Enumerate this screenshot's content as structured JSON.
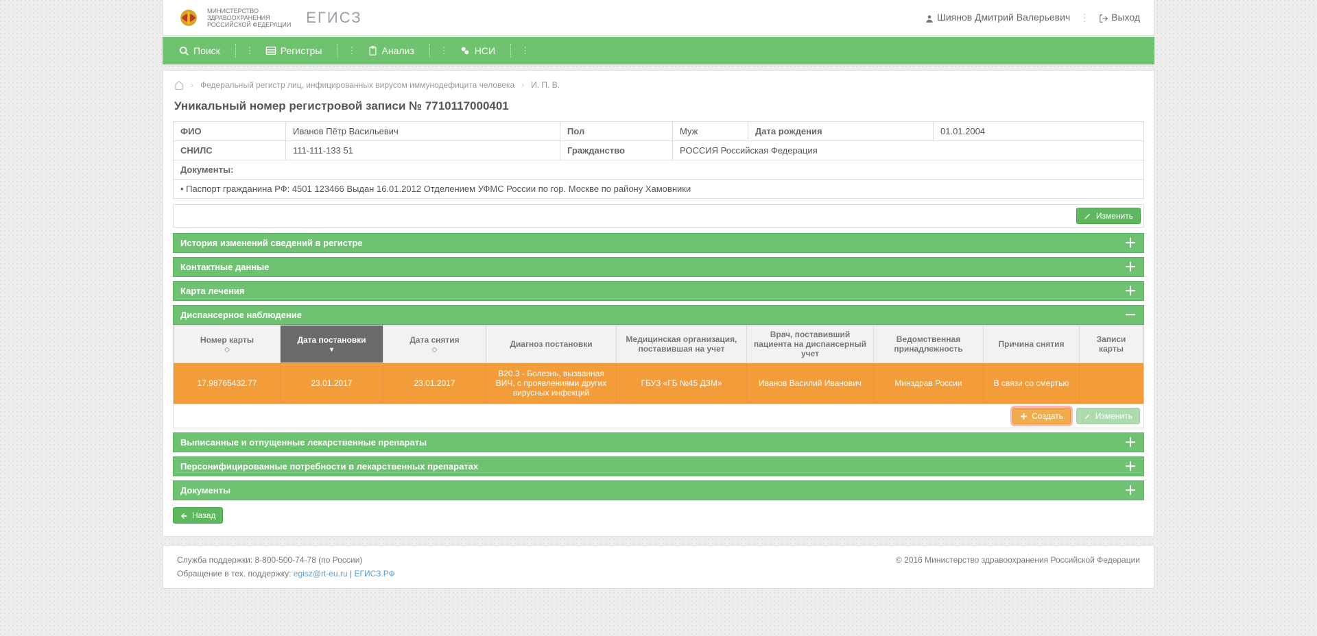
{
  "header": {
    "ministry_line1": "МИНИСТЕРСТВО",
    "ministry_line2": "ЗДРАВООХРАНЕНИЯ",
    "ministry_line3": "РОССИЙСКОЙ ФЕДЕРАЦИИ",
    "brand": "ЕГИСЗ",
    "user": "Шиянов Дмитрий Валерьевич",
    "logout": "Выход"
  },
  "nav": {
    "search": "Поиск",
    "registers": "Регистры",
    "analysis": "Анализ",
    "nsi": "НСИ"
  },
  "crumbs": {
    "l1": "Федеральный регистр лиц, инфицированных вирусом иммунодефицита человека",
    "l2": "И. П. В."
  },
  "title": "Уникальный номер регистровой записи № 7710117000401",
  "summary": {
    "fio_label": "ФИО",
    "fio": "Иванов Пётр Васильевич",
    "sex_label": "Пол",
    "sex": "Муж",
    "dob_label": "Дата рождения",
    "dob": "01.01.2004",
    "snils_label": "СНИЛС",
    "snils": "111-111-133 51",
    "citizen_label": "Гражданство",
    "citizen": "РОССИЯ Российская Федерация",
    "docs_label": "Документы:",
    "doc1": "• Паспорт гражданина РФ: 4501 123466 Выдан 16.01.2012 Отделением УФМС России по гор. Москве по району Хамовники"
  },
  "buttons": {
    "edit": "Изменить",
    "create": "Создать",
    "back": "Назад"
  },
  "sections": {
    "history": "История изменений сведений в регистре",
    "contacts": "Контактные данные",
    "treatment": "Карта лечения",
    "dispanser": "Диспансерное наблюдение",
    "drugs_out": "Выписанные и отпущенные лекарственные препараты",
    "drugs_need": "Персонифицированные потребности в лекарственных препаратах",
    "documents": "Документы"
  },
  "dispanser": {
    "cols": {
      "card_no": "Номер карты",
      "date_on": "Дата постановки",
      "date_off": "Дата снятия",
      "diag": "Диагноз постановки",
      "org": "Медицинская организация, поставившая на учет",
      "doctor": "Врач, поставивший пациента на диспансерный учет",
      "dept": "Ведомственная принадлежность",
      "reason": "Причина снятия",
      "records": "Записи карты"
    },
    "row": {
      "card_no": "17.98765432.77",
      "date_on": "23.01.2017",
      "date_off": "23.01.2017",
      "diag": "B20.3 - Болезнь, вызванная ВИЧ, с проявлениями других вирусных инфекций",
      "org": "ГБУЗ «ГБ №45 ДЗМ»",
      "doctor": "Иванов Василий Иванович",
      "dept": "Минздрав России",
      "reason": "В связи со смертью",
      "records": ""
    }
  },
  "footer": {
    "support": "Служба поддержки: 8-800-500-74-78 (по России)",
    "contact_pre": "Обращение в тех. поддержку: ",
    "email": "egisz@rt-eu.ru",
    "sep": "   |   ",
    "site": "ЕГИСЗ.РФ",
    "copy": "© 2016 Министерство здравоохранения Российской Федерации"
  }
}
